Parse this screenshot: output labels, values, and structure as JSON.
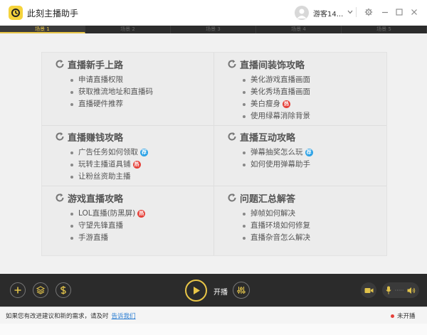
{
  "app": {
    "title": "此刻主播助手",
    "username": "游客14..."
  },
  "scene_tabs": [
    "场景 1",
    "场景 2",
    "场景 3",
    "场景 4",
    "场景 5"
  ],
  "sections": [
    {
      "title": "直播新手上路",
      "items": [
        {
          "label": "申请直播权限",
          "badge": null
        },
        {
          "label": "获取推流地址和直播码",
          "badge": null
        },
        {
          "label": "直播硬件推荐",
          "badge": null
        }
      ]
    },
    {
      "title": "直播间装饰攻略",
      "items": [
        {
          "label": "美化游戏直播画面",
          "badge": null
        },
        {
          "label": "美化秀场直播画面",
          "badge": null
        },
        {
          "label": "美白瘦身",
          "badge": "hot"
        },
        {
          "label": "使用绿幕消除背景",
          "badge": null
        }
      ]
    },
    {
      "title": "直播赚钱攻略",
      "items": [
        {
          "label": "广告任务如何领取",
          "badge": "rec"
        },
        {
          "label": "玩转主播道具铺",
          "badge": "hot"
        },
        {
          "label": "让粉丝资助主播",
          "badge": null
        }
      ]
    },
    {
      "title": "直播互动攻略",
      "items": [
        {
          "label": "弹幕抽奖怎么玩",
          "badge": "rec"
        },
        {
          "label": "如何使用弹幕助手",
          "badge": null
        }
      ]
    },
    {
      "title": "游戏直播攻略",
      "items": [
        {
          "label": "LOL直播(防黑屏)",
          "badge": "hot"
        },
        {
          "label": "守望先锋直播",
          "badge": null
        },
        {
          "label": "手游直播",
          "badge": null
        }
      ]
    },
    {
      "title": "问题汇总解答",
      "items": [
        {
          "label": "掉帧如何解决",
          "badge": null
        },
        {
          "label": "直播环境如何修复",
          "badge": null
        },
        {
          "label": "直播杂音怎么解决",
          "badge": null
        }
      ]
    }
  ],
  "badges": {
    "hot": "热",
    "rec": "荐"
  },
  "toolbar": {
    "start_label": "开播"
  },
  "status": {
    "message": "如果您有改进建议和新的需求，请及时",
    "link": "告诉我们",
    "live_status": "未开播"
  },
  "colors": {
    "accent": "#e8c547",
    "hot": "#e5413a",
    "rec": "#2fa3e6",
    "toolbar_bg": "#2b2b2b"
  },
  "icons": [
    "app-logo-icon",
    "avatar-icon",
    "chevron-down-icon",
    "gear-icon",
    "minimize-icon",
    "maximize-icon",
    "close-icon",
    "refresh-arrow-icon",
    "add-icon",
    "layers-icon",
    "dollar-icon",
    "play-icon",
    "mixer-icon",
    "camera-icon",
    "microphone-icon",
    "speaker-icon"
  ]
}
